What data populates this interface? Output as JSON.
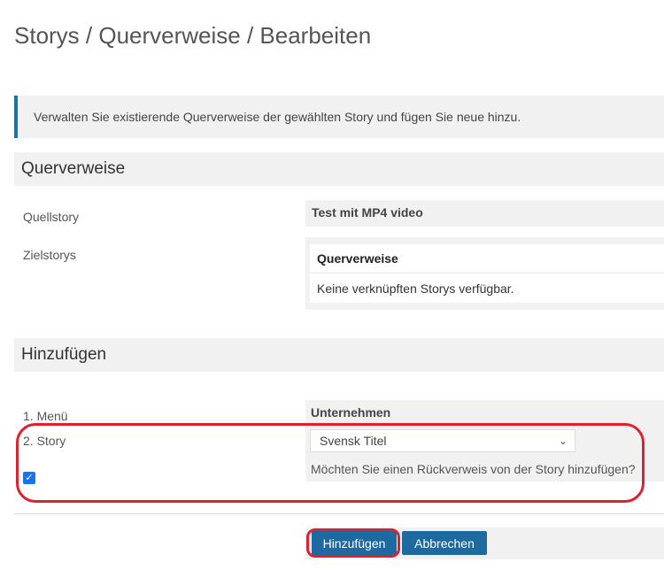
{
  "page": {
    "title": "Storys / Querverweise / Bearbeiten",
    "info": "Verwalten Sie existierende Querverweise der gewählten Story und fügen Sie neue hinzu."
  },
  "crossrefs": {
    "heading": "Querverweise",
    "source_label": "Quellstory",
    "source_value": "Test mit MP4 video",
    "target_label": "Zielstorys",
    "card_title": "Querverweise",
    "card_empty": "Keine verknüpften Storys verfügbar."
  },
  "add": {
    "heading": "Hinzufügen",
    "menu_label": "1. Menü",
    "menu_value": "Unternehmen",
    "story_label": "2. Story",
    "story_selected": "Svensk Titel",
    "backref_question": "Möchten Sie einen Rückverweis von der Story hinzufügen?",
    "backref_checked": true
  },
  "buttons": {
    "add": "Hinzufügen",
    "cancel": "Abbrechen"
  },
  "colors": {
    "accent": "#1c6aa0",
    "highlight": "#e0202e",
    "panel": "#f1f1f1"
  }
}
